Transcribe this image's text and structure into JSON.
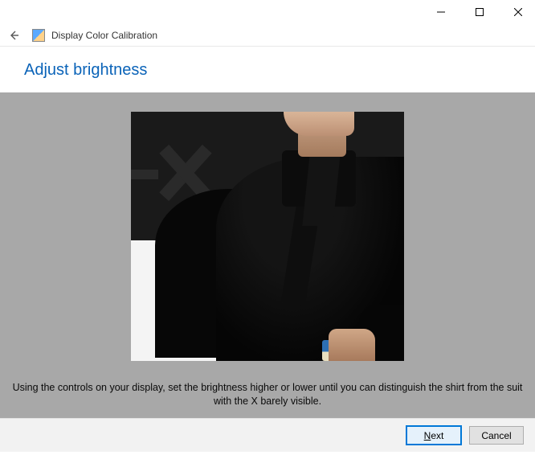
{
  "window": {
    "title": "Display Color Calibration"
  },
  "heading": "Adjust brightness",
  "instruction": "Using the controls on your display, set the brightness higher or lower until you can distinguish the shirt from the suit with the X barely visible.",
  "buttons": {
    "next": "Next",
    "cancel": "Cancel"
  }
}
